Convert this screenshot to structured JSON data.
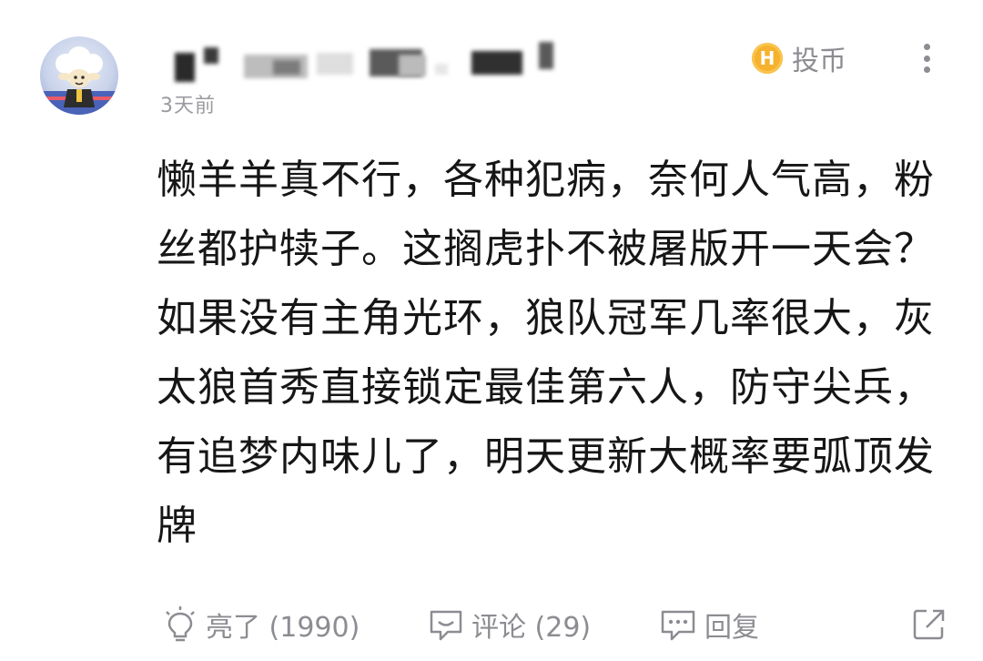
{
  "comment": {
    "time": "3天前",
    "coin_label": "投币",
    "coin_icon": "coin-icon",
    "content": "懒羊羊真不行，各种犯病，奈何人气高，粉丝都护犊子。这搁虎扑不被屠版开一天会？如果没有主角光环，狼队冠军几率很大，灰太狼首秀直接锁定最佳第六人，防守尖兵，有追梦内味儿了，明天更新大概率要弧顶发牌"
  },
  "actions": {
    "like_label": "亮了 (1990)",
    "comment_label": "评论 (29)",
    "reply_label": "回复"
  },
  "colors": {
    "text": "#161616",
    "muted": "#8c8c92",
    "coin": "#f6b22c"
  }
}
